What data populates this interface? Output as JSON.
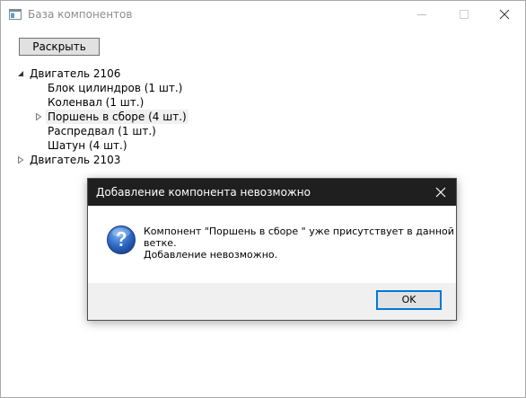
{
  "window": {
    "title": "База компонентов"
  },
  "toolbar": {
    "expand_label": "Раскрыть"
  },
  "tree": {
    "nodes": [
      {
        "label": "Двигатель 2106",
        "state": "expanded"
      },
      {
        "label": "Блок цилиндров (1 шт.)"
      },
      {
        "label": "Коленвал (1 шт.)"
      },
      {
        "label": "Поршень в сборе (4 шт.)",
        "state": "collapsed"
      },
      {
        "label": "Распредвал (1 шт.)"
      },
      {
        "label": "Шатун (4 шт.)"
      },
      {
        "label": "Двигатель 2103",
        "state": "collapsed"
      }
    ]
  },
  "dialog": {
    "title": "Добавление компонента невозможно",
    "icon": "question-icon",
    "message_line1": "Компонент \"Поршень в сборе \" уже присутствует в данной",
    "message_line2": "ветке.",
    "message_line3": "Добавление невозможно.",
    "ok_label": "OK"
  },
  "colors": {
    "dialog_titlebar": "#1f1f1f",
    "button_face": "#e1e1e1",
    "focus_border": "#0078d7",
    "footer_bg": "#f0f0f0"
  }
}
